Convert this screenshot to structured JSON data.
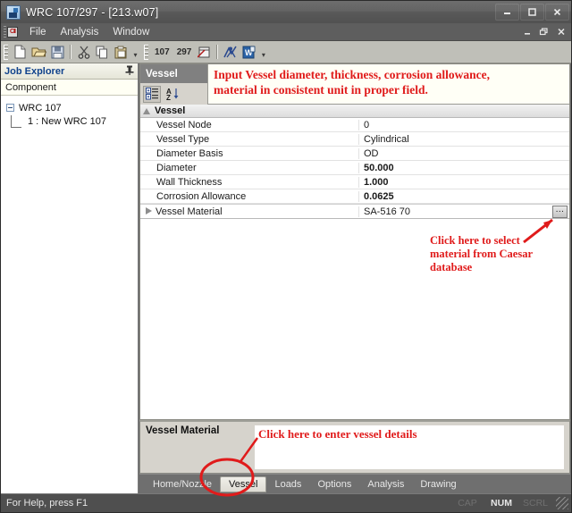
{
  "window": {
    "title": "WRC 107/297 - [213.w07]",
    "icon": "app-icon",
    "controls": [
      "minimize",
      "maximize",
      "close"
    ],
    "mdi_controls": [
      "minimize",
      "restore",
      "close"
    ]
  },
  "menubar": {
    "items": [
      "File",
      "Analysis",
      "Window"
    ]
  },
  "toolbar": {
    "group1": [
      "new-icon",
      "open-icon",
      "save-icon",
      "cut-icon",
      "copy-icon",
      "paste-icon"
    ],
    "group2_labels": [
      "107",
      "297"
    ],
    "group2_icons": [
      "window-icon",
      "run-icon",
      "word-report-icon"
    ],
    "overflow": "overflow-chevron"
  },
  "explorer": {
    "title": "Job Explorer",
    "pin": "pin-icon",
    "column_header": "Component",
    "tree": {
      "root": "WRC 107",
      "child": "1 : New WRC 107"
    }
  },
  "property_panel": {
    "selector_value": "Vessel",
    "view_icons": [
      "categorized-view-icon",
      "alphabetical-sort-icon"
    ],
    "annotation": "Input Vessel diameter, thickness, corrosion allowance,\nmaterial in consistent unit in proper field.",
    "category": "Vessel",
    "rows": [
      {
        "name": "Vessel Node",
        "value": "0",
        "bold": false,
        "expandable": false,
        "selected": false
      },
      {
        "name": "Vessel Type",
        "value": "Cylindrical",
        "bold": false,
        "expandable": false,
        "selected": false
      },
      {
        "name": "Diameter Basis",
        "value": "OD",
        "bold": false,
        "expandable": false,
        "selected": false
      },
      {
        "name": "Diameter",
        "value": "50.000",
        "bold": true,
        "expandable": false,
        "selected": false
      },
      {
        "name": "Wall Thickness",
        "value": "1.000",
        "bold": true,
        "expandable": false,
        "selected": false
      },
      {
        "name": "Corrosion Allowance",
        "value": "0.0625",
        "bold": true,
        "expandable": false,
        "selected": false
      },
      {
        "name": "Vessel Material",
        "value": "SA-516 70",
        "bold": false,
        "expandable": true,
        "selected": true
      }
    ],
    "ellipsis_button_label": "…"
  },
  "description": {
    "title": "Vessel Material",
    "annotation": "Click here to enter vessel details"
  },
  "annotations": {
    "material_db": "Click here to select\nmaterial from Caesar\ndatabase",
    "color": "#e01b1b"
  },
  "tabs": [
    {
      "label": "Home/Nozzle",
      "active": false
    },
    {
      "label": "Vessel",
      "active": true
    },
    {
      "label": "Loads",
      "active": false
    },
    {
      "label": "Options",
      "active": false
    },
    {
      "label": "Analysis",
      "active": false
    },
    {
      "label": "Drawing",
      "active": false
    }
  ],
  "statusbar": {
    "hint": "For Help, press F1",
    "indicators": [
      {
        "label": "CAP",
        "active": false
      },
      {
        "label": "NUM",
        "active": true
      },
      {
        "label": "SCRL",
        "active": false
      }
    ]
  }
}
